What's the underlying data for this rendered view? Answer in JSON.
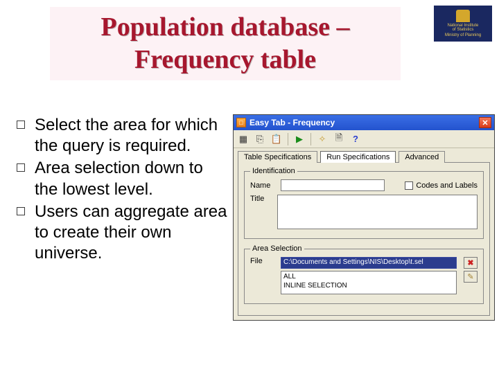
{
  "title": "Population database – Frequency table",
  "logo": {
    "line1": "National Institute",
    "line2": "of Statistics",
    "line3": "Ministry of Planning"
  },
  "bullets": [
    "Select the area for which the query is required.",
    "Area selection down to the lowest level.",
    "Users can aggregate area to create their own universe."
  ],
  "dialog": {
    "window_title": "Easy Tab - Frequency",
    "toolbar_icons": [
      "grid",
      "copy",
      "paste",
      "sep",
      "play",
      "sep",
      "magic",
      "clip",
      "help"
    ],
    "tabs": {
      "table_spec": "Table Specifications",
      "run_spec": "Run Specifications",
      "advanced": "Advanced"
    },
    "identification": {
      "legend": "Identification",
      "name_label": "Name",
      "name_value": "",
      "codes_labels": "Codes and Labels",
      "title_label": "Title",
      "title_value": ""
    },
    "area": {
      "legend": "Area Selection",
      "file_label": "File",
      "file_value": "C:\\Documents and Settings\\NIS\\Desktop\\t.sel",
      "list": [
        "ALL",
        "INLINE SELECTION"
      ]
    }
  }
}
